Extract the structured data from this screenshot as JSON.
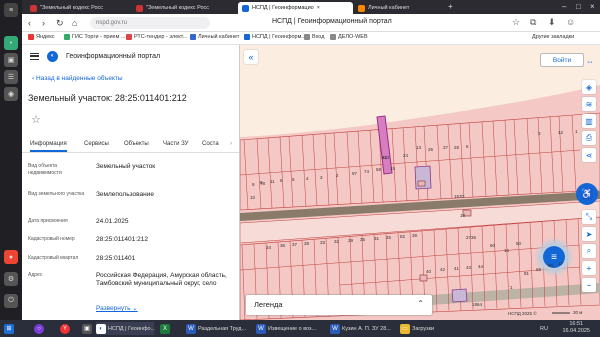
{
  "browser": {
    "tabs": [
      {
        "label": "\"Земельный кодекс Росс",
        "active": false
      },
      {
        "label": "\"Земельный кодекс Росс",
        "active": false
      },
      {
        "label": "НСПД | Геоинформацио",
        "active": true
      },
      {
        "label": "Личный кабинет",
        "active": false
      }
    ],
    "url": "nspd.gov.ru",
    "page_title": "НСПД | Геоинформационный портал",
    "bookmarks": [
      "Яндекс",
      "ГИС Торги - прием ...",
      "РТС-тендер - элект...",
      "Личный кабинет",
      "НСПД | Геоинформ...",
      "Вход",
      "ДЕЛО-WEB"
    ],
    "other_bookmarks": "Другие закладки"
  },
  "panel": {
    "app_title": "Геоинформационный портал",
    "back_link": "Назад в найденные объекты",
    "object_title": "Земельный участок: 28:25:011401:212",
    "tabs": [
      "Информация",
      "Сервисы",
      "Объекты",
      "Части ЗУ",
      "Соста"
    ],
    "fields": [
      {
        "label": "Вид объекта недвижимости",
        "value": "Земельный участок"
      },
      {
        "label": "Вид земельного участка",
        "value": "Землепользование"
      },
      {
        "label": "Дата присвоения",
        "value": "24.01.2025"
      },
      {
        "label": "Кадастровый номер",
        "value": "28:25:011401:212"
      },
      {
        "label": "Кадастровый квартал",
        "value": "28:25:011401"
      },
      {
        "label": "Адрес",
        "value": "Российская Федерация, Амурская область, Тамбовский муниципальный округ, село"
      }
    ],
    "expand_link": "Развернуть"
  },
  "map": {
    "login_label": "Войти",
    "legend_label": "Легенда",
    "scale_label": "30 м",
    "copyright": "НСПД 2025 ©",
    "parcel_numbers": [
      "212",
      "24",
      "13",
      "26",
      "27",
      "28",
      "5",
      "3",
      "12",
      "1",
      "9",
      "8",
      "10",
      "78",
      "11",
      "6",
      "5",
      "4",
      "3",
      "2",
      "97",
      "74",
      "58",
      "15",
      "1570",
      "36",
      "37",
      "38",
      "34",
      "33",
      "32",
      "29",
      "35",
      "31",
      "25",
      "82",
      "39",
      "40",
      "42",
      "41",
      "43",
      "44",
      "2736",
      "60",
      "16",
      "50",
      "1964",
      "1",
      "81",
      "69",
      "68",
      "17",
      "18",
      "63"
    ]
  },
  "taskbar": {
    "items": [
      "НСПД | Геоинфо...",
      "Раздельная Труд...",
      "Извещение о воз...",
      "Кузин А. П. ЗУ 28...",
      "Загрузки"
    ],
    "lang": "RU",
    "time": "16:51",
    "date": "16.04.2025"
  },
  "colors": {
    "accent": "#1366d6",
    "parcel_fill": "#f4c8c4",
    "parcel_stroke": "#c04040",
    "selected": "#b04a9a"
  }
}
